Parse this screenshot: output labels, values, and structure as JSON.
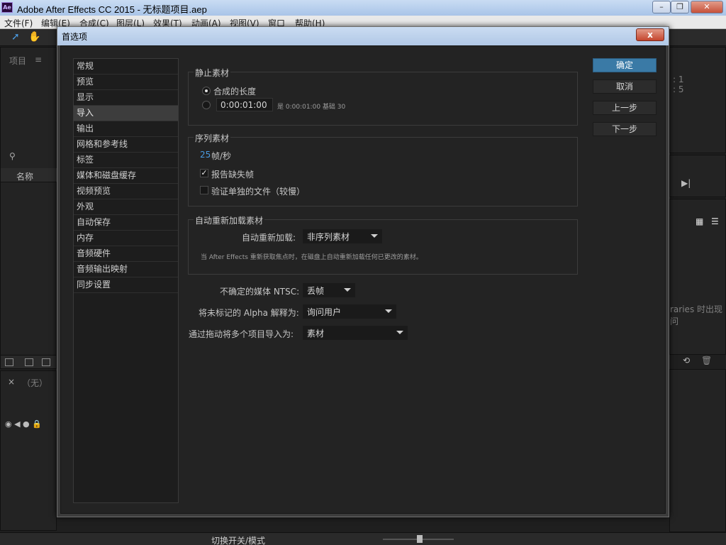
{
  "window": {
    "title": "Adobe After Effects CC 2015 - 无标题项目.aep",
    "logo": "Ae"
  },
  "menu": [
    "文件(F)",
    "编辑(E)",
    "合成(C)",
    "图层(L)",
    "效果(T)",
    "动画(A)",
    "视图(V)",
    "窗口",
    "帮助(H)"
  ],
  "background": {
    "project_label": "项目",
    "name_col": "名称",
    "none_label": "（无）",
    "switch_mode": "切换开关/模式",
    "right_readout_1": ": 1",
    "right_readout_2": ": 5",
    "right_text": "raries 时出现问"
  },
  "dialog": {
    "title": "首选项",
    "close_glyph": "x",
    "categories": [
      "常规",
      "预览",
      "显示",
      "导入",
      "输出",
      "网格和参考线",
      "标签",
      "媒体和磁盘缓存",
      "视频预览",
      "外观",
      "自动保存",
      "内存",
      "音频硬件",
      "音频输出映射",
      "同步设置"
    ],
    "selected_index": 3,
    "still": {
      "group_label": "静止素材",
      "option1": "合成的长度",
      "option2_value": "0:00:01:00",
      "option2_note": "是 0:00:01:00  基础 30"
    },
    "sequence": {
      "group_label": "序列素材",
      "fps_value": "25",
      "fps_unit": "帧/秒",
      "report_missing": "报告缺失帧",
      "verify_files": "验证单独的文件（较慢）"
    },
    "auto_reload": {
      "group_label": "自动重新加载素材",
      "label": "自动重新加载:",
      "value": "非序列素材",
      "description": "当 After Effects 重新获取焦点时，在磁盘上自动重新加载任何已更改的素材。"
    },
    "ntsc": {
      "label": "不确定的媒体 NTSC:",
      "value": "丢帧"
    },
    "alpha": {
      "label": "将未标记的 Alpha 解释为:",
      "value": "询问用户"
    },
    "drag_import": {
      "label": "通过拖动将多个项目导入为:",
      "value": "素材"
    },
    "buttons": {
      "ok": "确定",
      "cancel": "取消",
      "prev": "上一步",
      "next": "下一步"
    }
  }
}
